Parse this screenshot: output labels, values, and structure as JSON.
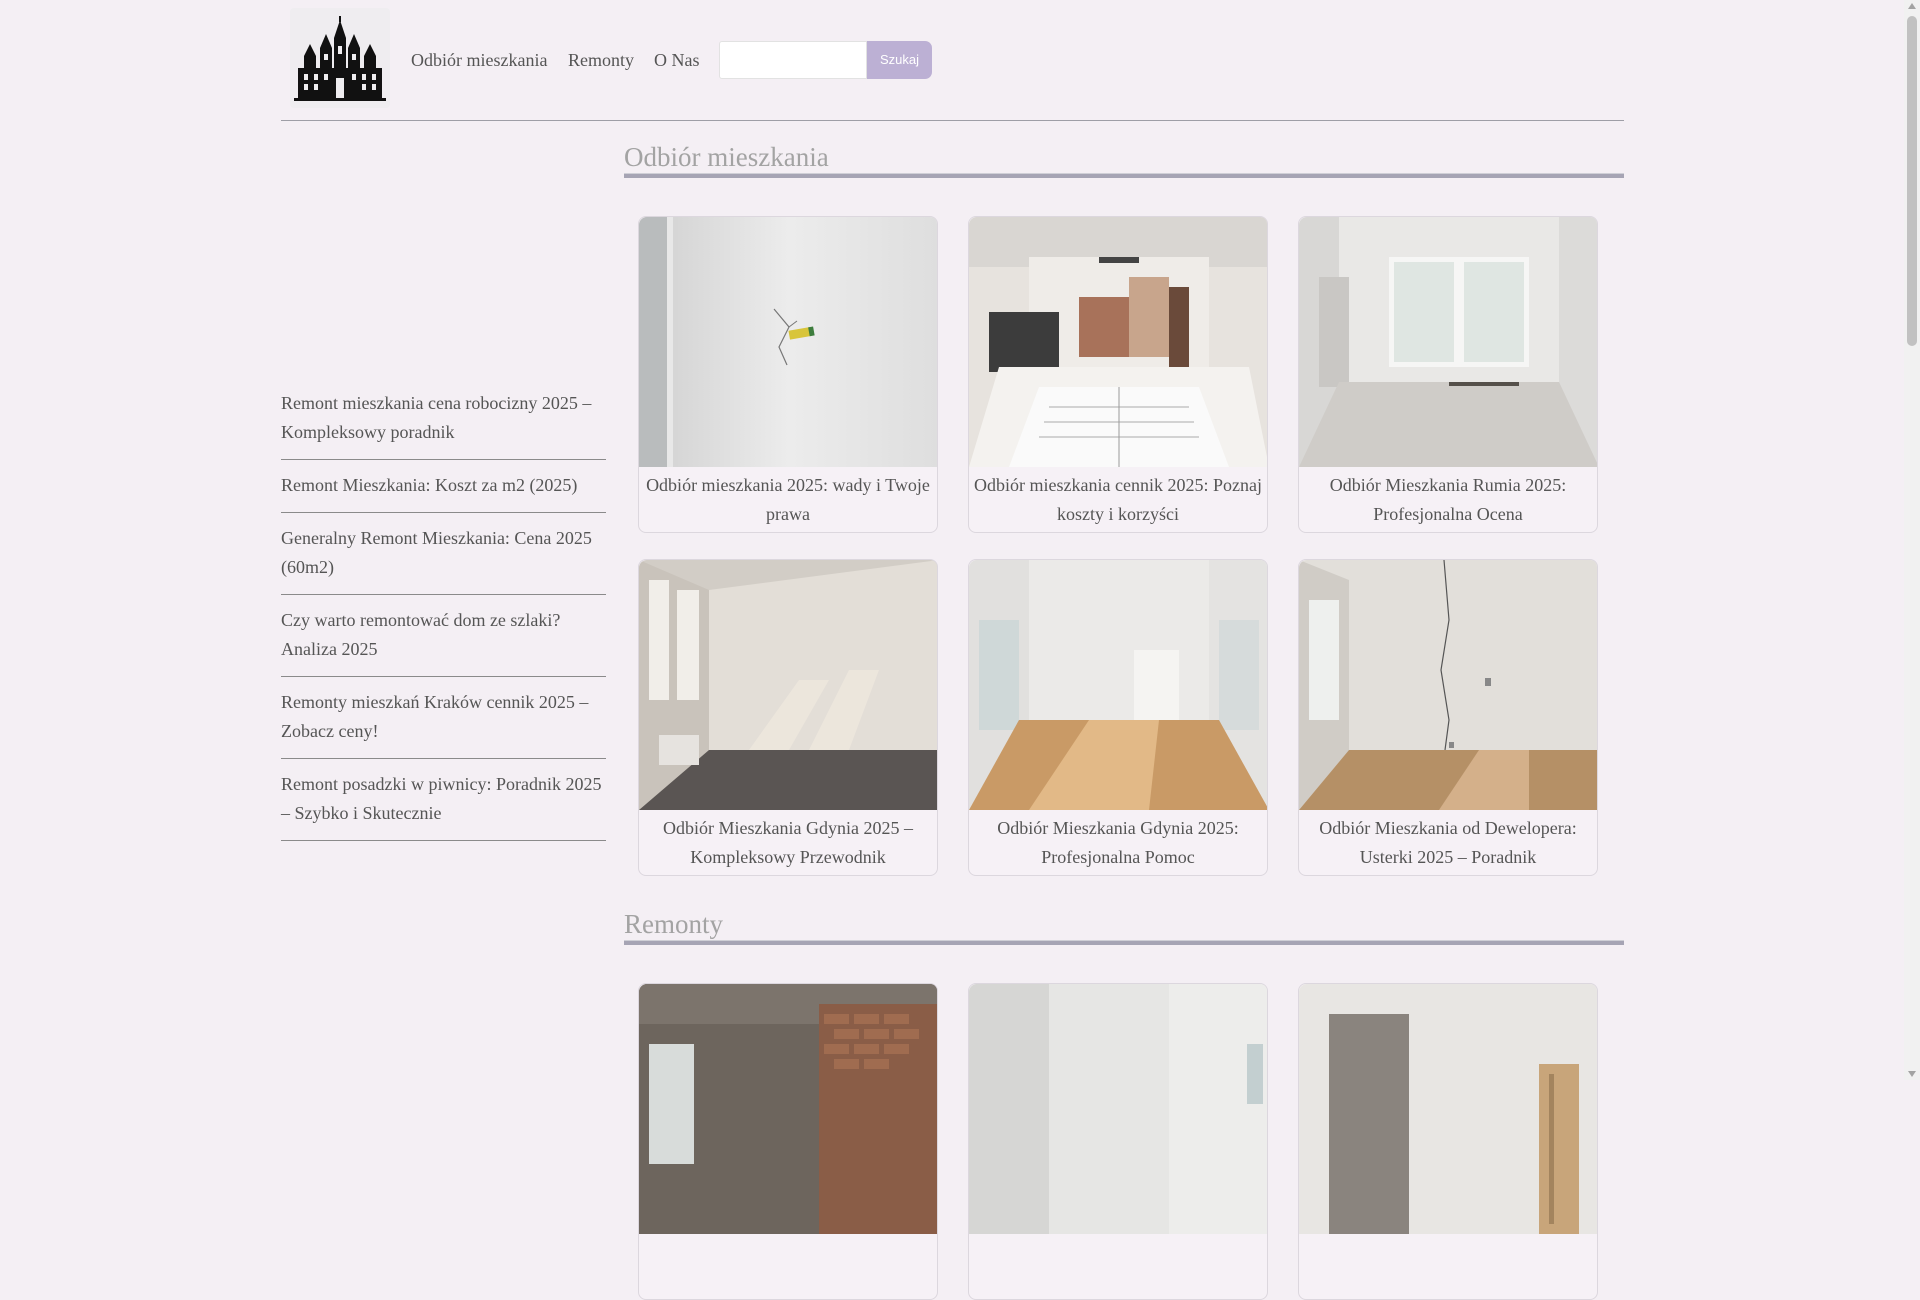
{
  "header": {
    "logo_name": "castle-logo",
    "nav": [
      {
        "label": "Odbiór mieszkania"
      },
      {
        "label": "Remonty"
      },
      {
        "label": "O Nas"
      }
    ],
    "search": {
      "placeholder": "",
      "button_label": "Szukaj"
    }
  },
  "sidebar": {
    "items": [
      {
        "label": "Remont mieszkania cena robocizny 2025 – Kompleksowy poradnik"
      },
      {
        "label": "Remont Mieszkania: Koszt za m2 (2025)"
      },
      {
        "label": "Generalny Remont Mieszkania: Cena 2025 (60m2)"
      },
      {
        "label": "Czy warto remontować dom ze szlaki? Analiza 2025"
      },
      {
        "label": "Remonty mieszkań Kraków cennik 2025 – Zobacz ceny!"
      },
      {
        "label": "Remont posadzki w piwnicy: Poradnik 2025 – Szybko i Skutecznie"
      }
    ]
  },
  "sections": [
    {
      "title": "Odbiór mieszkania",
      "cards": [
        {
          "title": "Odbiór mieszkania 2025: wady i Twoje prawa"
        },
        {
          "title": "Odbiór mieszkania cennik 2025: Poznaj koszty i korzyści"
        },
        {
          "title": "Odbiór Mieszkania Rumia 2025: Profesjonalna Ocena"
        },
        {
          "title": "Odbiór Mieszkania Gdynia 2025 – Kompleksowy Przewodnik"
        },
        {
          "title": "Odbiór Mieszkania Gdynia 2025: Profesjonalna Pomoc"
        },
        {
          "title": "Odbiór Mieszkania od Dewelopera: Usterki 2025 – Poradnik"
        }
      ]
    },
    {
      "title": "Remonty",
      "cards": [
        {
          "title": ""
        },
        {
          "title": ""
        },
        {
          "title": ""
        }
      ]
    }
  ],
  "colors": {
    "background": "#f4eff4",
    "accent": "#bcb0d4",
    "rule": "#a6a4b4"
  }
}
